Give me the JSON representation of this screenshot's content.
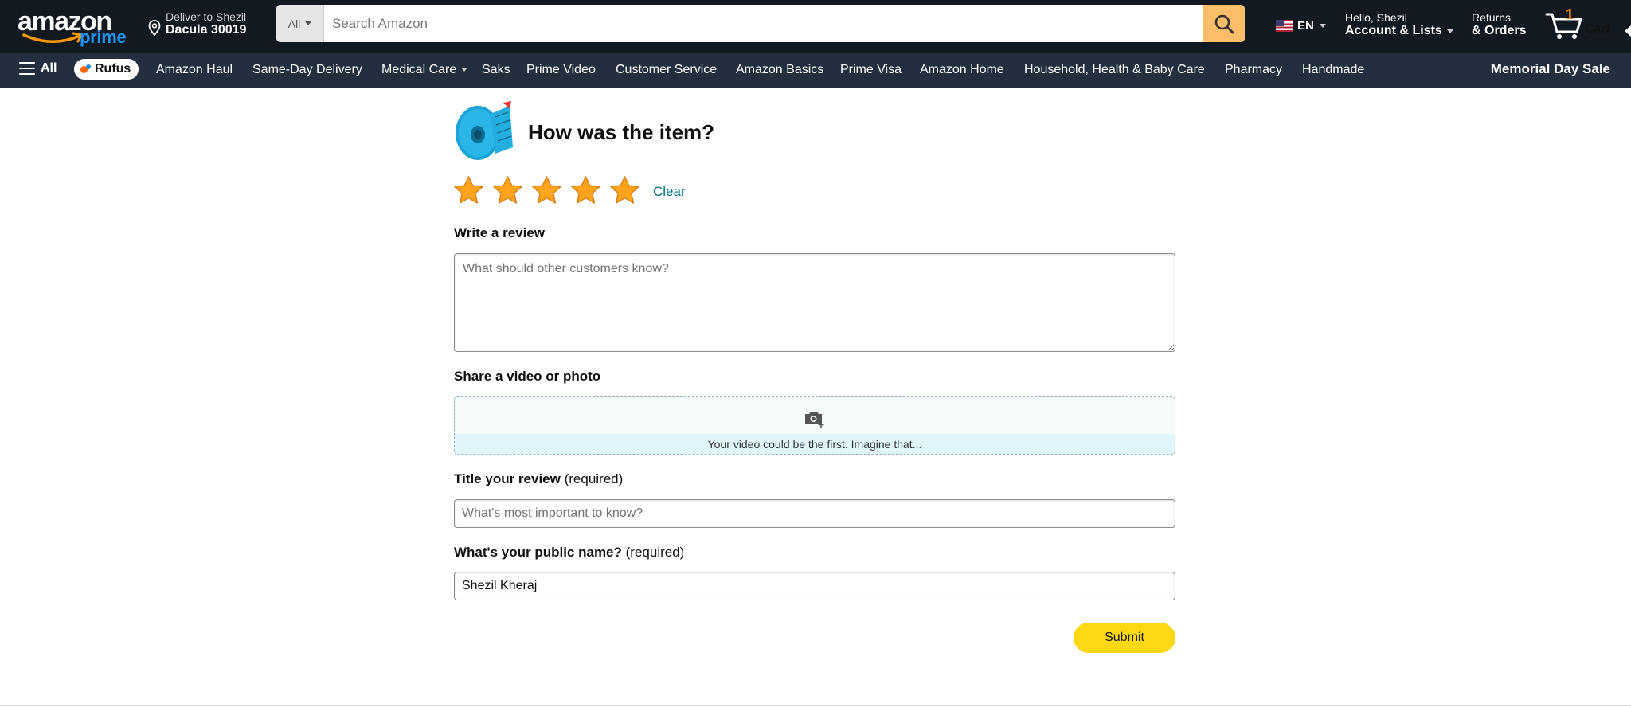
{
  "header": {
    "logo_text": "amazon",
    "logo_sub": "prime",
    "deliver_line1": "Deliver to Shezil",
    "deliver_line2": "Dacula 30019",
    "search_category": "All",
    "search_placeholder": "Search Amazon",
    "language": "EN",
    "account_line1": "Hello, Shezil",
    "account_line2": "Account & Lists",
    "returns_line1": "Returns",
    "returns_line2": "& Orders",
    "cart_count": "1",
    "cart_label": "Cart"
  },
  "subnav": {
    "all_label": "All",
    "rufus_label": "Rufus",
    "items": [
      "Amazon Haul",
      "Same-Day Delivery",
      "Medical Care",
      "Saks",
      "Prime Video",
      "Customer Service",
      "Amazon Basics",
      "Prime Visa",
      "Amazon Home",
      "Household, Health & Baby Care",
      "Pharmacy",
      "Handmade"
    ],
    "promo": "Memorial Day Sale"
  },
  "review": {
    "title": "How was the item?",
    "rating": 5,
    "rating_max": 5,
    "clear_label": "Clear",
    "write_label": "Write a review",
    "write_placeholder": "What should other customers know?",
    "share_label": "Share a video or photo",
    "upload_message": "Your video could be the first. Imagine that...",
    "title_label": "Title your review",
    "title_required": "(required)",
    "title_placeholder": "What's most important to know?",
    "name_label": "What's your public name?",
    "name_required": "(required)",
    "name_value": "Shezil Kheraj",
    "submit_label": "Submit"
  },
  "colors": {
    "nav_bg": "#131921",
    "subnav_bg": "#232f3e",
    "search_button": "#febd69",
    "star": "#ffa41c",
    "link": "#007185",
    "submit_button": "#ffd814"
  },
  "icons": {
    "logo": "amazon-smile-logo",
    "pin": "location-pin-icon",
    "search": "search-icon",
    "flag": "us-flag-icon",
    "cart": "cart-icon",
    "menu": "hamburger-menu-icon",
    "camera": "camera-add-icon",
    "star": "star-icon"
  }
}
